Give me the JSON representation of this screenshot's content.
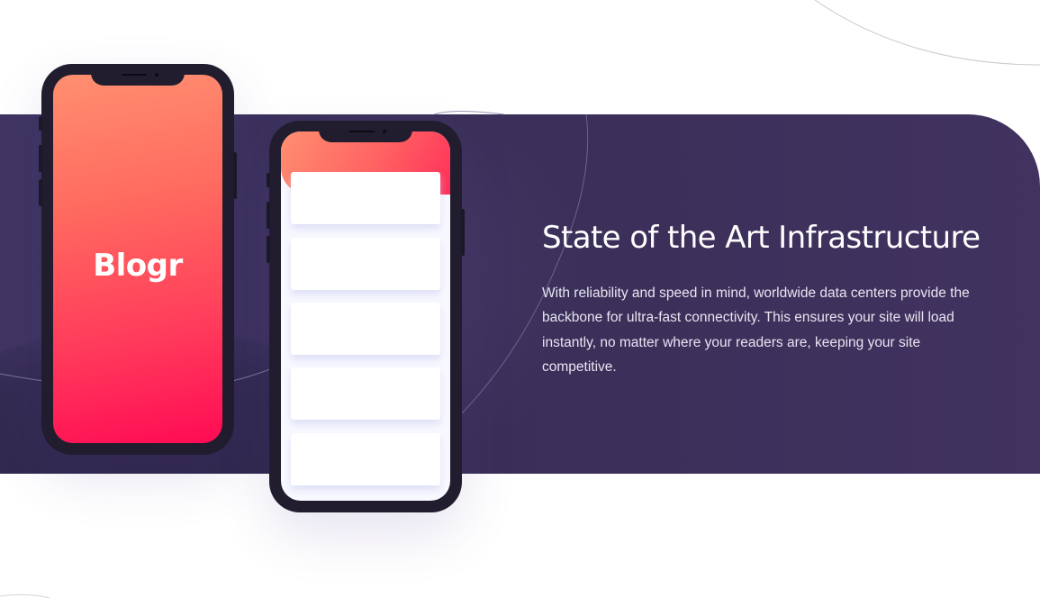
{
  "phones": {
    "left": {
      "logo_text": "Blogr"
    },
    "right": {
      "card_count": 5
    }
  },
  "infrastructure": {
    "heading": "State of the Art Infrastructure",
    "description": "With reliability and speed in mind, worldwide data centers provide the backbone for ultra-fast connectivity. This ensures your site will load instantly, no matter where your readers are, keeping your site competitive."
  },
  "colors": {
    "band": "#3f3462",
    "gradient_start": "#ff8f70",
    "gradient_end": "#ff3d54",
    "phone_frame": "#211d2f",
    "heading": "#ffffff",
    "text": "#e8e5f2"
  }
}
